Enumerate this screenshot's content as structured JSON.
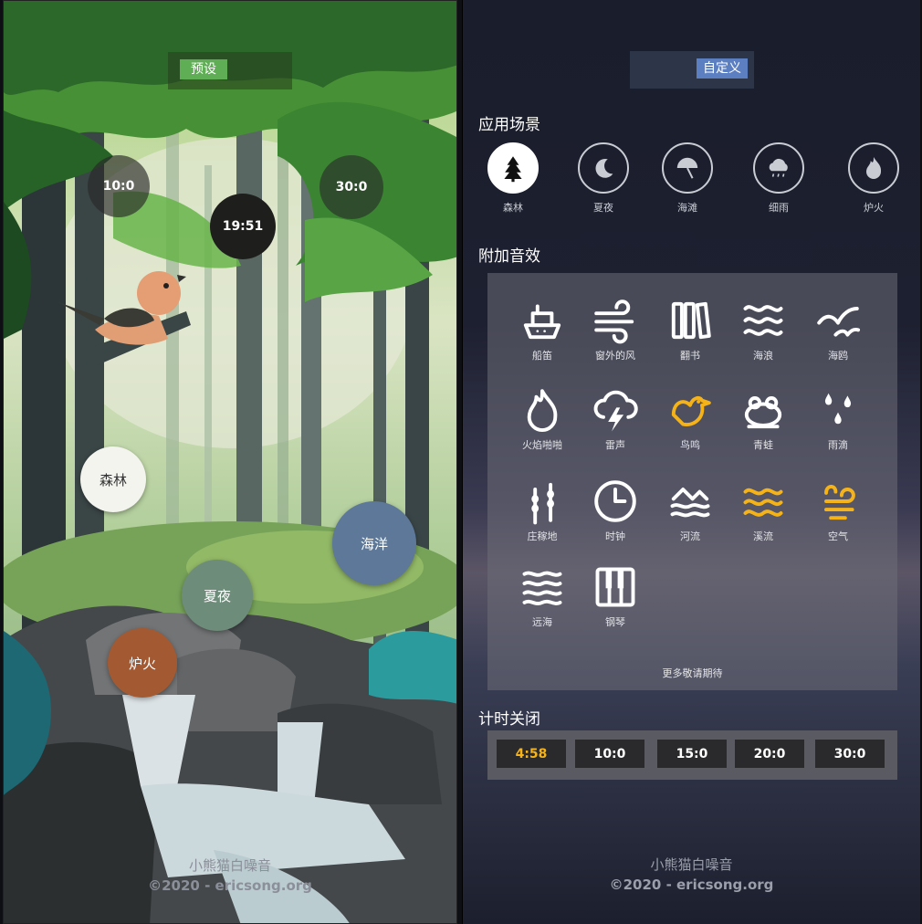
{
  "left": {
    "tab_preset": "预设",
    "timers": [
      "10:0",
      "19:51",
      "30:0"
    ],
    "bubbles": [
      {
        "label": "森林",
        "bg": "#f4f4ef",
        "fg": "#333333"
      },
      {
        "label": "海洋",
        "bg": "#5d7898",
        "fg": "#ffffff"
      },
      {
        "label": "夏夜",
        "bg": "#6e8c7a",
        "fg": "#ffffff"
      },
      {
        "label": "炉火",
        "bg": "#a35a32",
        "fg": "#ffffff"
      }
    ],
    "footer_title": "小熊猫白噪音",
    "footer_copy": "©2020 - ericsong.org"
  },
  "right": {
    "tab_custom": "自定义",
    "section_scenes": "应用场景",
    "scenes": [
      {
        "label": "森林",
        "icon": "tree-icon",
        "active": true
      },
      {
        "label": "夏夜",
        "icon": "moon-icon",
        "active": false
      },
      {
        "label": "海滩",
        "icon": "umbrella-icon",
        "active": false
      },
      {
        "label": "细雨",
        "icon": "rain-cloud-icon",
        "active": false
      },
      {
        "label": "炉火",
        "icon": "flame-icon",
        "active": false
      }
    ],
    "section_sfx": "附加音效",
    "sfx": [
      {
        "label": "船笛",
        "icon": "ship-icon",
        "active": false
      },
      {
        "label": "窗外的风",
        "icon": "wind-icon",
        "active": false
      },
      {
        "label": "翻书",
        "icon": "book-icon",
        "active": false
      },
      {
        "label": "海浪",
        "icon": "waves-icon",
        "active": false
      },
      {
        "label": "海鸥",
        "icon": "seagull-icon",
        "active": false
      },
      {
        "label": "火焰啪啪",
        "icon": "fire-icon",
        "active": false
      },
      {
        "label": "雷声",
        "icon": "thunder-icon",
        "active": false
      },
      {
        "label": "鸟鸣",
        "icon": "bird-icon",
        "active": true
      },
      {
        "label": "青蛙",
        "icon": "frog-icon",
        "active": false
      },
      {
        "label": "雨滴",
        "icon": "raindrops-icon",
        "active": false
      },
      {
        "label": "庄稼地",
        "icon": "wheat-icon",
        "active": false
      },
      {
        "label": "时钟",
        "icon": "clock-icon",
        "active": false
      },
      {
        "label": "河流",
        "icon": "river-icon",
        "active": false
      },
      {
        "label": "溪流",
        "icon": "stream-icon",
        "active": true
      },
      {
        "label": "空气",
        "icon": "air-icon",
        "active": true
      },
      {
        "label": "远海",
        "icon": "far-sea-icon",
        "active": false
      },
      {
        "label": "钢琴",
        "icon": "piano-icon",
        "active": false
      }
    ],
    "more_text": "更多敬请期待",
    "section_timer": "计时关闭",
    "timer_options": [
      "4:58",
      "10:0",
      "15:0",
      "20:0",
      "30:0"
    ],
    "timer_active_index": 0,
    "footer_title": "小熊猫白噪音",
    "footer_copy": "©2020 - ericsong.org"
  },
  "colors": {
    "active_icon": "#f5b318",
    "inactive_icon": "#ffffff",
    "preset_tab": "#5fae55",
    "custom_tab": "#5b7fc0"
  }
}
